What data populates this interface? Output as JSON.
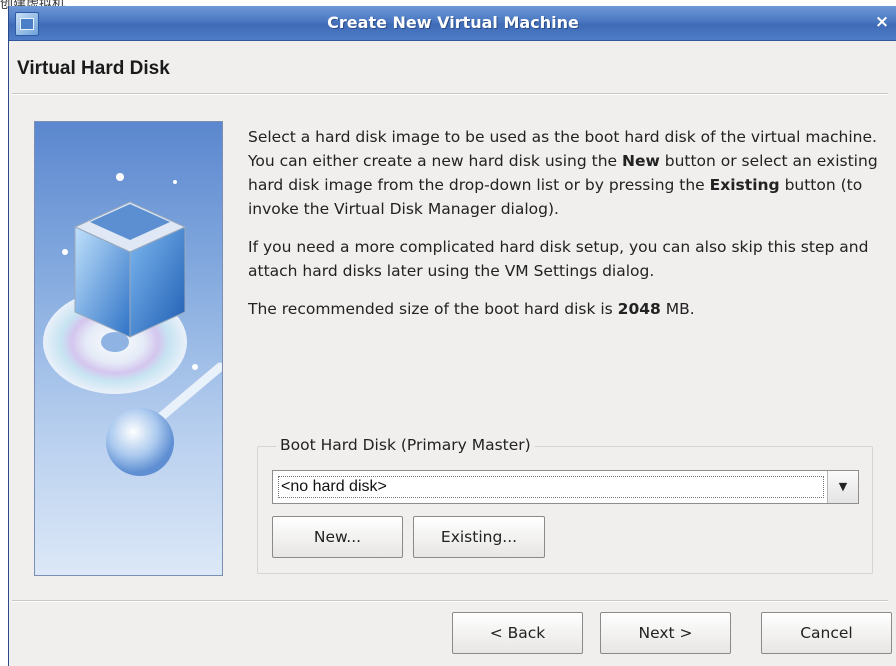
{
  "stray_text": "创建虚拟机",
  "window": {
    "title": "Create New Virtual Machine",
    "close_label": "×"
  },
  "page": {
    "heading": "Virtual Hard Disk"
  },
  "description": {
    "p1_a": "Select a hard disk image to be used as the boot hard disk of the virtual machine. You can either create a new hard disk using the ",
    "p1_b1": "New",
    "p1_c": " button or select an existing hard disk image from the drop-down list or by pressing the ",
    "p1_b2": "Existing",
    "p1_d": " button (to invoke the Virtual Disk Manager dialog).",
    "p2": "If you need a more complicated hard disk setup, you can also skip this step and attach hard disks later using the VM Settings dialog.",
    "p3_a": "The recommended size of the boot hard disk is ",
    "p3_b": "2048",
    "p3_c": " MB."
  },
  "boot_disk": {
    "group_title": "Boot Hard Disk (Primary Master)",
    "selected": "<no hard disk>",
    "new_label": "New...",
    "existing_label": "Existing..."
  },
  "footer": {
    "back_label": "< Back",
    "next_label": "Next >",
    "cancel_label": "Cancel"
  },
  "colors": {
    "titlebar": "#4a77c1",
    "window_bg": "#f0efee",
    "artwork": "#5b87cf"
  },
  "icons": [
    "virtualbox-app-icon",
    "close-icon",
    "dropdown-arrow-icon",
    "virtualbox-cube-artwork"
  ]
}
